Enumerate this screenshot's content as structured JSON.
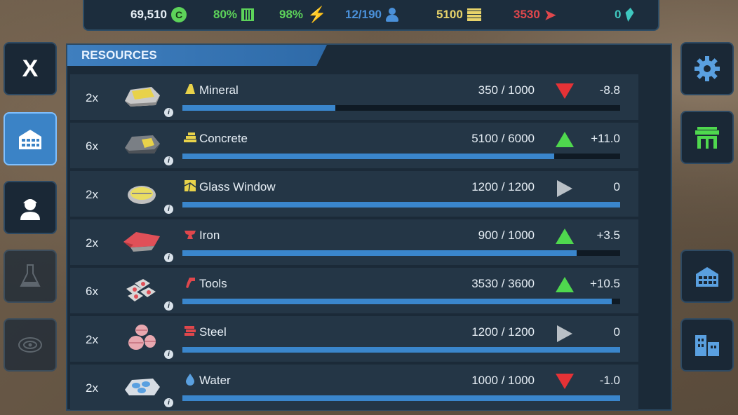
{
  "topbar": {
    "credits": "69,510",
    "credits_icon": "C",
    "cpu": "80%",
    "power": "98%",
    "workers": "12/190",
    "concrete": "5100",
    "tools": "3530",
    "gems": "0"
  },
  "panel": {
    "title": "RESOURCES"
  },
  "close_label": "X",
  "info_label": "i",
  "colors": {
    "up": "#4fd84e",
    "down": "#e53236",
    "flat": "#b9c0c6",
    "bar": "#3a86cc"
  },
  "resources": [
    {
      "qty": "2x",
      "name": "Mineral",
      "amount": "350 / 1000",
      "rate": "-8.8",
      "trend": "down",
      "fill": 0.35,
      "icon": "mineral-icon"
    },
    {
      "qty": "6x",
      "name": "Concrete",
      "amount": "5100 / 6000",
      "rate": "+11.0",
      "trend": "up",
      "fill": 0.85,
      "icon": "concrete-icon"
    },
    {
      "qty": "2x",
      "name": "Glass Window",
      "amount": "1200 / 1200",
      "rate": "0",
      "trend": "flat",
      "fill": 1.0,
      "icon": "glass-icon"
    },
    {
      "qty": "2x",
      "name": "Iron",
      "amount": "900 / 1000",
      "rate": "+3.5",
      "trend": "up",
      "fill": 0.9,
      "icon": "iron-icon"
    },
    {
      "qty": "6x",
      "name": "Tools",
      "amount": "3530 / 3600",
      "rate": "+10.5",
      "trend": "up",
      "fill": 0.98,
      "icon": "tools-icon"
    },
    {
      "qty": "2x",
      "name": "Steel",
      "amount": "1200 / 1200",
      "rate": "0",
      "trend": "flat",
      "fill": 1.0,
      "icon": "steel-icon"
    },
    {
      "qty": "2x",
      "name": "Water",
      "amount": "1000 / 1000",
      "rate": "-1.0",
      "trend": "down",
      "fill": 1.0,
      "icon": "water-icon"
    }
  ]
}
